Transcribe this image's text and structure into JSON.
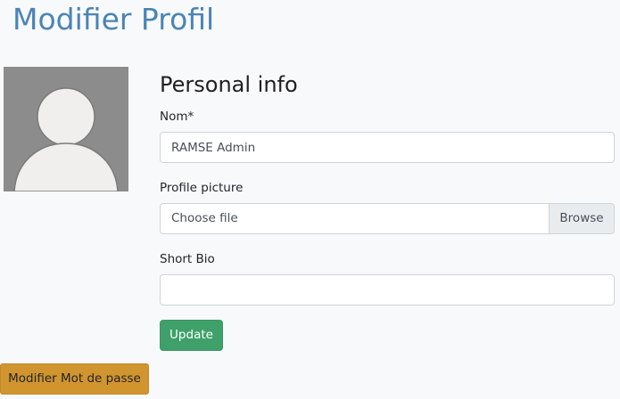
{
  "header": {
    "title": "Modifier Profil"
  },
  "avatar": {
    "icon": "default-user-avatar-icon",
    "background_color": "#8c8c8c",
    "figure_color": "#f0efed"
  },
  "form": {
    "section_title": "Personal info",
    "name": {
      "label": "Nom*",
      "value": "RAMSE Admin"
    },
    "profile_picture": {
      "label": "Profile picture",
      "placeholder": "Choose file",
      "browse_label": "Browse"
    },
    "short_bio": {
      "label": "Short Bio",
      "value": ""
    },
    "update_label": "Update"
  },
  "actions": {
    "change_password_label": "Modifier Mot de passe"
  },
  "colors": {
    "title": "#4a84b6",
    "update_button": "#3fa06a",
    "password_button": "#d1952f",
    "background": "#f8f9fb"
  }
}
